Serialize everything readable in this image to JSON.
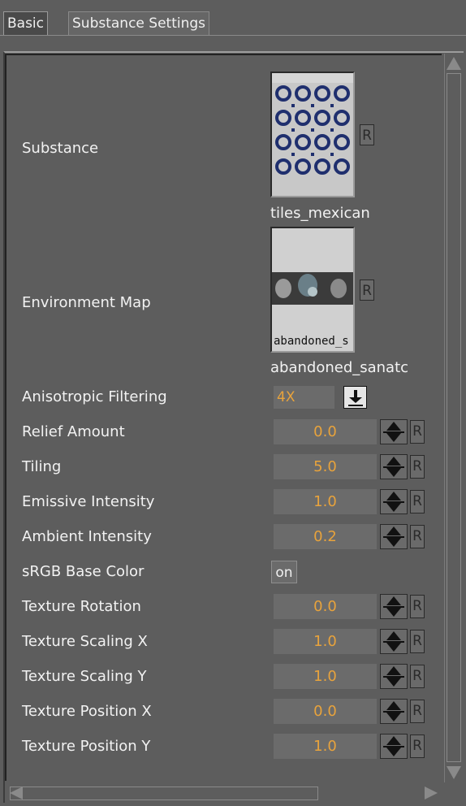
{
  "tabs": [
    {
      "label": "Basic"
    },
    {
      "label": "Substance Settings"
    }
  ],
  "substance": {
    "label": "Substance",
    "name": "tiles_mexican",
    "reset": "R"
  },
  "environment_map": {
    "label": "Environment Map",
    "thumb_caption": "abandoned_s",
    "name": "abandoned_sanatc",
    "reset": "R"
  },
  "anisotropic": {
    "label": "Anisotropic Filtering",
    "value": "4X"
  },
  "fields": [
    {
      "label": "Relief Amount",
      "value": "0.0",
      "reset": "R"
    },
    {
      "label": "Tiling",
      "value": "5.0",
      "reset": "R"
    },
    {
      "label": "Emissive Intensity",
      "value": "1.0",
      "reset": "R"
    },
    {
      "label": "Ambient Intensity",
      "value": "0.2",
      "reset": "R"
    }
  ],
  "srgb": {
    "label": "sRGB Base Color",
    "value": "on"
  },
  "fields2": [
    {
      "label": "Texture Rotation",
      "value": "0.0",
      "reset": "R"
    },
    {
      "label": "Texture Scaling X",
      "value": "1.0",
      "reset": "R"
    },
    {
      "label": "Texture Scaling Y",
      "value": "1.0",
      "reset": "R"
    },
    {
      "label": "Texture Position X",
      "value": "0.0",
      "reset": "R"
    },
    {
      "label": "Texture Position Y",
      "value": "1.0",
      "reset": "R"
    }
  ],
  "colors": {
    "background": "#5d5d5d",
    "value_text": "#e8a33c",
    "field_bg": "#6b6b6b"
  }
}
